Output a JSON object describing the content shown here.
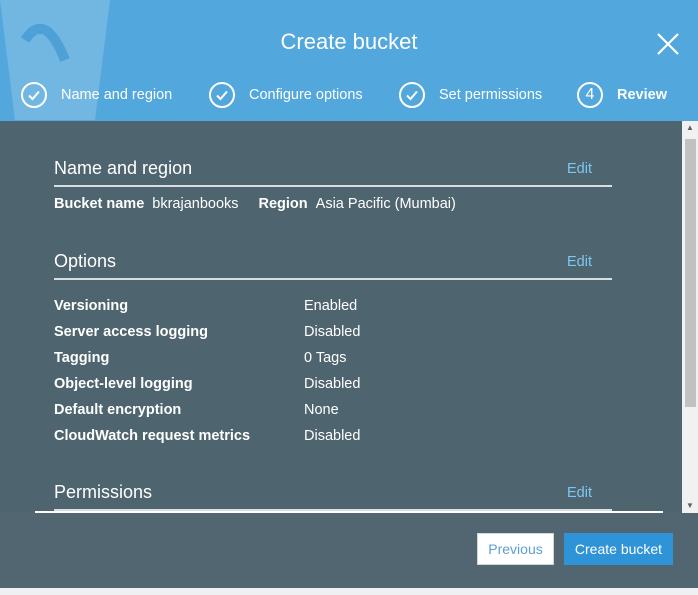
{
  "modal": {
    "title": "Create bucket",
    "steps": [
      {
        "label": "Name and region",
        "state": "done"
      },
      {
        "label": "Configure options",
        "state": "done"
      },
      {
        "label": "Set permissions",
        "state": "done"
      },
      {
        "label": "Review",
        "state": "active",
        "number": "4"
      }
    ]
  },
  "review": {
    "name_region": {
      "heading": "Name and region",
      "edit": "Edit",
      "bucket_label": "Bucket name",
      "bucket_value": "bkrajanbooks",
      "region_label": "Region",
      "region_value": "Asia Pacific (Mumbai)"
    },
    "options": {
      "heading": "Options",
      "edit": "Edit",
      "rows": [
        {
          "k": "Versioning",
          "v": "Enabled"
        },
        {
          "k": "Server access logging",
          "v": "Disabled"
        },
        {
          "k": "Tagging",
          "v": "0 Tags"
        },
        {
          "k": "Object-level logging",
          "v": "Disabled"
        },
        {
          "k": "Default encryption",
          "v": "None"
        },
        {
          "k": "CloudWatch request metrics",
          "v": "Disabled"
        }
      ]
    },
    "permissions": {
      "heading": "Permissions",
      "edit": "Edit"
    }
  },
  "footer": {
    "previous": "Previous",
    "create": "Create bucket"
  },
  "colors": {
    "header": "#52a7dc",
    "body": "#4e646f",
    "link": "#7cc8f2",
    "primary_button": "#2f93d8"
  }
}
